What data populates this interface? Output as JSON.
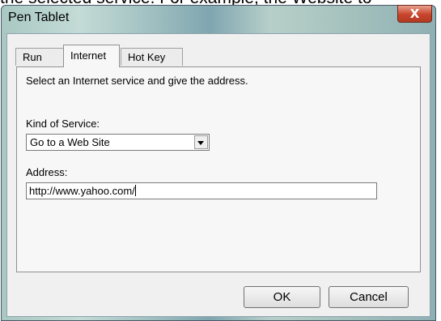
{
  "background_caption": "the selected service. For example, the Website to",
  "window": {
    "title": "Pen Tablet",
    "close_label": "X"
  },
  "tabs": [
    {
      "label": "Run",
      "active": false
    },
    {
      "label": "Internet",
      "active": true
    },
    {
      "label": "Hot Key",
      "active": false
    }
  ],
  "panel": {
    "instruction": "Select an Internet service and give the address.",
    "service_label": "Kind of Service:",
    "service_value": "Go to a Web Site",
    "address_label": "Address:",
    "address_value": "http://www.yahoo.com/"
  },
  "buttons": {
    "ok": "OK",
    "cancel": "Cancel"
  }
}
